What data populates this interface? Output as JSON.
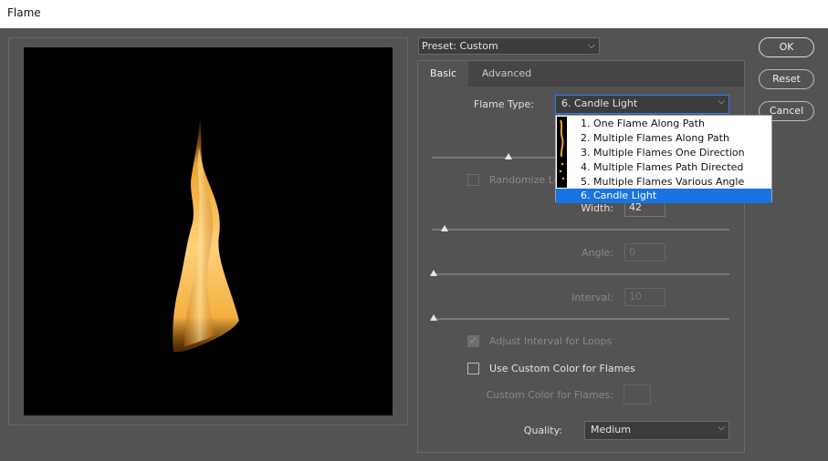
{
  "window": {
    "title": "Flame"
  },
  "preset": {
    "label": "Preset:",
    "value": "Custom"
  },
  "buttons": {
    "ok": "OK",
    "reset": "Reset",
    "cancel": "Cancel"
  },
  "tabs": [
    {
      "label": "Basic",
      "active": true
    },
    {
      "label": "Advanced",
      "active": false
    }
  ],
  "flame_type": {
    "label": "Flame Type:",
    "value": "6. Candle Light",
    "options": [
      "1. One Flame Along Path",
      "2. Multiple Flames Along Path",
      "3. Multiple Flames One Direction",
      "4. Multiple Flames Path Directed",
      "5. Multiple Flames Various Angle",
      "6. Candle Light"
    ],
    "selected_index": 5
  },
  "randomize": {
    "label": "Randomize Le",
    "checked": false,
    "enabled": false
  },
  "width": {
    "label": "Width:",
    "value": "42"
  },
  "angle": {
    "label": "Angle:",
    "value": "0",
    "enabled": false
  },
  "interval": {
    "label": "Interval:",
    "value": "10",
    "enabled": false
  },
  "adjust_interval": {
    "label": "Adjust Interval for Loops",
    "checked": true,
    "enabled": false
  },
  "custom_color": {
    "label": "Use Custom Color for Flames",
    "checked": false
  },
  "custom_color_swatch": {
    "label": "Custom Color for Flames:",
    "enabled": false
  },
  "quality": {
    "label": "Quality:",
    "value": "Medium"
  },
  "icons": {
    "chevron": "chevron-down-icon",
    "flame": "flame-preview"
  },
  "colors": {
    "accent": "#1874e0",
    "background": "#535353",
    "preview_bg": "#000000",
    "flame_core": "#ffd27a",
    "flame_edge": "#e08a1a"
  }
}
